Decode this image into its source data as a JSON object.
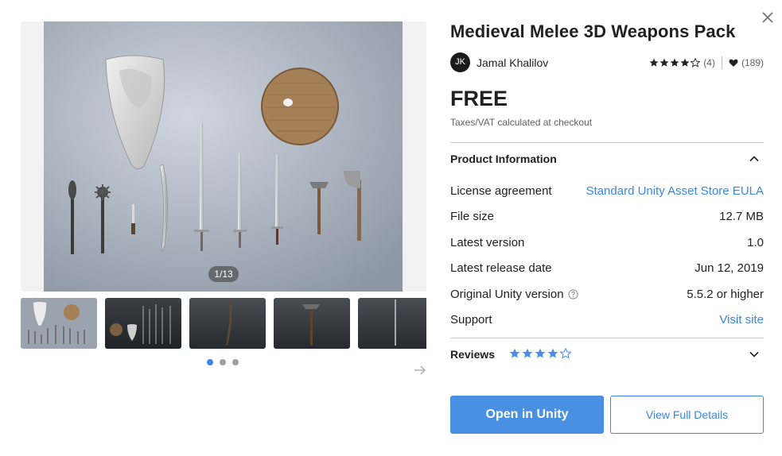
{
  "product": {
    "title": "Medieval Melee 3D Weapons Pack",
    "author_initials": "JK",
    "author_name": "Jamal Khalilov",
    "rating": 4,
    "rating_count": "(4)",
    "favorites_count": "(189)",
    "price": "FREE",
    "tax_note": "Taxes/VAT calculated at checkout"
  },
  "gallery": {
    "counter": "1/13",
    "current_page": 1,
    "total_pages": 13,
    "dots_total": 3,
    "dots_active": 1
  },
  "product_info": {
    "title": "Product Information",
    "expanded": true,
    "rows": [
      {
        "label": "License agreement",
        "value": "Standard Unity Asset Store EULA",
        "is_link": true
      },
      {
        "label": "File size",
        "value": "12.7 MB",
        "is_link": false
      },
      {
        "label": "Latest version",
        "value": "1.0",
        "is_link": false
      },
      {
        "label": "Latest release date",
        "value": "Jun 12, 2019",
        "is_link": false
      },
      {
        "label": "Original Unity version",
        "value": "5.5.2 or higher",
        "is_link": false
      },
      {
        "label": "Support",
        "value": "Visit site",
        "is_link": true
      }
    ]
  },
  "reviews": {
    "title": "Reviews",
    "rating": 4,
    "expanded": false
  },
  "actions": {
    "open_in_unity": "Open in Unity",
    "view_full_details": "View Full Details"
  },
  "icons": {
    "close": "close-icon",
    "star": "star-icon",
    "heart": "heart-icon",
    "help": "help-circle-icon",
    "chevron_up": "chevron-up-icon",
    "chevron_down": "chevron-down-icon",
    "arrow_right": "arrow-right-icon"
  },
  "colors": {
    "accent": "#4a90e2",
    "link": "#3a87e6",
    "text": "#212121",
    "muted": "#616161"
  }
}
